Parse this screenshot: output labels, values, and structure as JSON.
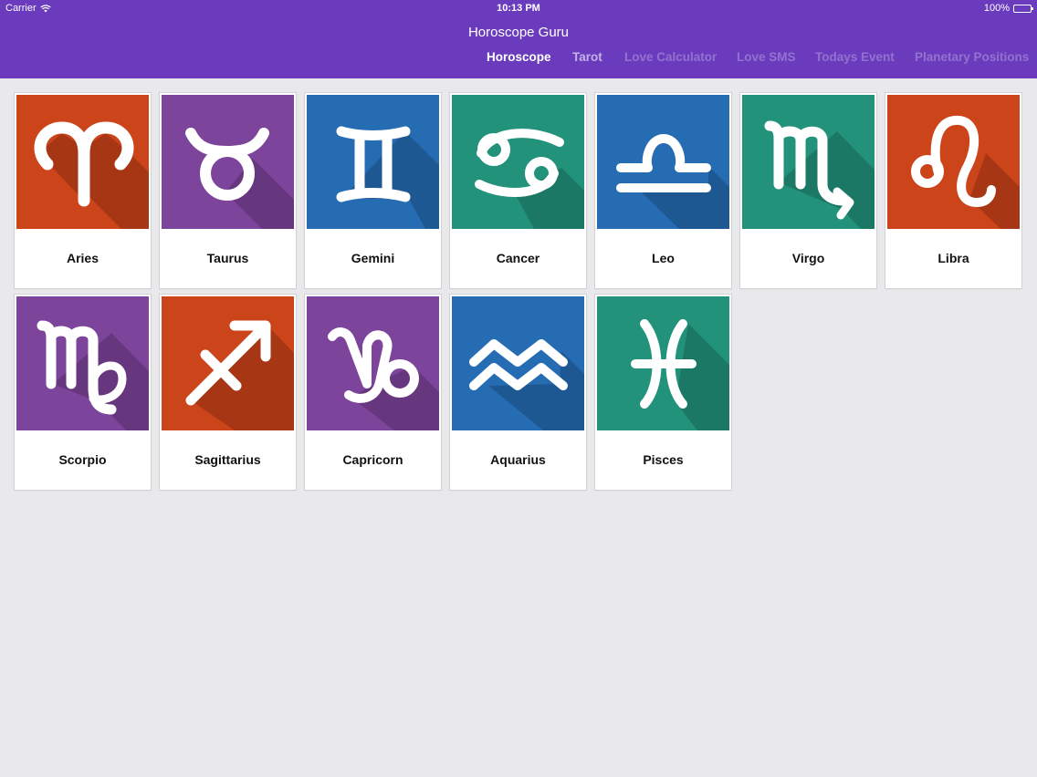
{
  "status_bar": {
    "carrier": "Carrier",
    "time": "10:13 PM",
    "battery": "100%"
  },
  "app": {
    "title": "Horoscope Guru"
  },
  "tabs": [
    {
      "label": "Horoscope",
      "state": "active"
    },
    {
      "label": "Tarot",
      "state": "dim"
    },
    {
      "label": "Love Calculator",
      "state": "faded"
    },
    {
      "label": "Love SMS",
      "state": "faded"
    },
    {
      "label": "Todays Event",
      "state": "faded"
    },
    {
      "label": "Planetary Positions",
      "state": "faded"
    }
  ],
  "colors": {
    "header": "#6a3bbd",
    "orange": "#cc4419",
    "purple": "#7d449b",
    "blue": "#256cb3",
    "green": "#22937a"
  },
  "signs": [
    {
      "label": "Aries",
      "icon": "aries-icon",
      "color": "orange"
    },
    {
      "label": "Taurus",
      "icon": "taurus-icon",
      "color": "purple"
    },
    {
      "label": "Gemini",
      "icon": "gemini-icon",
      "color": "blue"
    },
    {
      "label": "Cancer",
      "icon": "cancer-icon",
      "color": "green"
    },
    {
      "label": "Leo",
      "icon": "libra-icon",
      "color": "blue"
    },
    {
      "label": "Virgo",
      "icon": "scorpio-icon",
      "color": "green"
    },
    {
      "label": "Libra",
      "icon": "leo-icon",
      "color": "orange"
    },
    {
      "label": "Scorpio",
      "icon": "virgo-icon",
      "color": "purple"
    },
    {
      "label": "Sagittarius",
      "icon": "sagittarius-icon",
      "color": "orange"
    },
    {
      "label": "Capricorn",
      "icon": "capricorn-icon",
      "color": "purple"
    },
    {
      "label": "Aquarius",
      "icon": "aquarius-icon",
      "color": "blue"
    },
    {
      "label": "Pisces",
      "icon": "pisces-icon",
      "color": "green"
    }
  ]
}
